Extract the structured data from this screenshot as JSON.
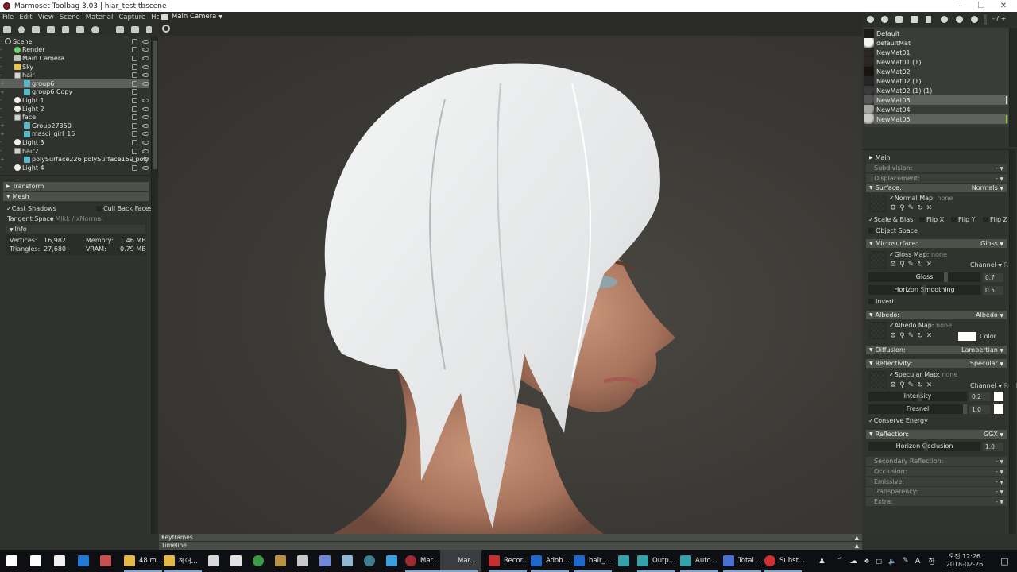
{
  "window": {
    "title": "Marmoset Toolbag 3.03  |  hiar_test.tbscene",
    "controls": [
      "minimize",
      "restore",
      "close"
    ]
  },
  "menu": [
    "File",
    "Edit",
    "View",
    "Scene",
    "Material",
    "Capture",
    "Help"
  ],
  "toolbar_left_icons": [
    "add-mesh-icon",
    "add-light-icon",
    "add-camera-icon",
    "add-sky-icon",
    "add-fog-icon",
    "add-shadow-catcher-icon",
    "add-turntable-icon",
    "folder-icon",
    "duplicate-icon",
    "delete-icon"
  ],
  "viewport": {
    "camera_label": "Main Camera",
    "keyframes_label": "Keyframes",
    "timeline_label": "Timeline"
  },
  "scene_tree": [
    {
      "label": "Scene",
      "icon": "scene",
      "depth": 0,
      "eye": true
    },
    {
      "label": "Render",
      "icon": "render",
      "depth": 1,
      "eye": true
    },
    {
      "label": "Main Camera",
      "icon": "cam",
      "depth": 1,
      "eye": true
    },
    {
      "label": "Sky",
      "icon": "sky",
      "depth": 1,
      "eye": true
    },
    {
      "label": "hair",
      "icon": "group",
      "depth": 1,
      "eye": true
    },
    {
      "label": "group6",
      "icon": "mesh",
      "depth": 2,
      "eye": true,
      "selected": true
    },
    {
      "label": "group6 Copy",
      "icon": "mesh",
      "depth": 2,
      "eye": false
    },
    {
      "label": "Light 1",
      "icon": "light",
      "depth": 1,
      "eye": true
    },
    {
      "label": "Light 2",
      "icon": "light",
      "depth": 1,
      "eye": true
    },
    {
      "label": "face",
      "icon": "group",
      "depth": 1,
      "eye": true
    },
    {
      "label": "Group27350",
      "icon": "mesh",
      "depth": 2,
      "eye": true
    },
    {
      "label": "masci_girl_15",
      "icon": "mesh",
      "depth": 2,
      "eye": true
    },
    {
      "label": "Light 3",
      "icon": "light",
      "depth": 1,
      "eye": true
    },
    {
      "label": "hair2",
      "icon": "group",
      "depth": 1,
      "eye": true
    },
    {
      "label": "polySurface226 polySurface159 poly",
      "icon": "mesh",
      "depth": 2,
      "eye": true
    },
    {
      "label": "Light 4",
      "icon": "light",
      "depth": 1,
      "eye": true
    }
  ],
  "object_props": {
    "transform_label": "Transform",
    "mesh_label": "Mesh",
    "cast_shadows": {
      "label": "Cast Shadows",
      "checked": true
    },
    "cull_back_faces": {
      "label": "Cull Back Faces",
      "checked": false
    },
    "tangent_space_label": "Tangent Space",
    "tangent_space_value": "Mikk / xNormal",
    "info_label": "Info",
    "vertices_label": "Vertices:",
    "vertices_value": "16,982",
    "triangles_label": "Triangles:",
    "triangles_value": "27,680",
    "memory_label": "Memory:",
    "memory_value": "1.46 MB",
    "vram_label": "VRAM:",
    "vram_value": "0.79 MB"
  },
  "material_toolbar": {
    "icons": [
      "add-material-icon",
      "duplicate-material-icon",
      "material-grid-icon",
      "folder-icon",
      "delete-icon",
      "pick-material-icon",
      "compass-icon",
      "search-material-icon"
    ],
    "zoom_label": "- / +"
  },
  "materials": [
    {
      "name": "Default",
      "thumb": "#1c1d1b"
    },
    {
      "name": "defaultMat",
      "thumb": "#f4f4f2"
    },
    {
      "name": "NewMat01",
      "thumb": "#2a2622"
    },
    {
      "name": "NewMat01 (1)",
      "thumb": "#2b2724"
    },
    {
      "name": "NewMat02",
      "thumb": "#1a1410"
    },
    {
      "name": "NewMat02 (1)",
      "thumb": "#262626"
    },
    {
      "name": "NewMat02 (1) (1)",
      "thumb": "#3a3a3a"
    },
    {
      "name": "NewMat03",
      "thumb": "#555",
      "selected": true
    },
    {
      "name": "NewMat04",
      "thumb": "#a6a6a2"
    },
    {
      "name": "NewMat05",
      "thumb": "#c9c9c5",
      "selected": true,
      "active": true
    }
  ],
  "material_props": {
    "main_label": "Main",
    "subdivision": {
      "label": "Subdivision:",
      "value": "-"
    },
    "displacement": {
      "label": "Displacement:",
      "value": "-"
    },
    "surface": {
      "label": "Surface:",
      "value": "Normals"
    },
    "normal_map": {
      "label": "Normal Map:",
      "value": "none"
    },
    "scale_bias": "Scale & Bias",
    "flip_x": "Flip X",
    "flip_y": "Flip Y",
    "flip_z": "Flip Z",
    "object_space": "Object Space",
    "microsurface": {
      "label": "Microsurface:",
      "value": "Gloss"
    },
    "gloss_map": {
      "label": "Gloss Map:",
      "value": "none"
    },
    "gloss_channel": {
      "label": "Channel",
      "value": "R"
    },
    "gloss": {
      "label": "Gloss",
      "value": "0.7",
      "fraction": 0.7
    },
    "horizon_smoothing": {
      "label": "Horizon Smoothing",
      "value": "0.5",
      "fraction": 0.5
    },
    "invert": "Invert",
    "albedo": {
      "label": "Albedo:",
      "value": "Albedo"
    },
    "albedo_map": {
      "label": "Albedo Map:",
      "value": "none"
    },
    "albedo_color_label": "Color",
    "albedo_color": "#ffffff",
    "diffusion": {
      "label": "Diffusion:",
      "value": "Lambertian"
    },
    "reflectivity": {
      "label": "Reflectivity:",
      "value": "Specular"
    },
    "specular_map": {
      "label": "Specular Map:",
      "value": "none"
    },
    "spec_channel": {
      "label": "Channel",
      "value": "RGB"
    },
    "intensity": {
      "label": "Intensity",
      "value": "0.2",
      "fraction": 0.2
    },
    "fresnel": {
      "label": "Fresnel",
      "value": "1.0",
      "fraction": 1.0
    },
    "conserve_energy": "Conserve Energy",
    "reflection": {
      "label": "Reflection:",
      "value": "GGX"
    },
    "horizon_occlusion": {
      "label": "Horizon Occlusion",
      "value": "1.0",
      "fraction": 1.0
    },
    "secondary_reflection": {
      "label": "Secondary Reflection:",
      "value": "-"
    },
    "occlusion": {
      "label": "Occlusion:",
      "value": "-"
    },
    "emissive": {
      "label": "Emissive:",
      "value": "-"
    },
    "transparency": {
      "label": "Transparency:",
      "value": "-"
    },
    "extra": {
      "label": "Extra:",
      "value": "-"
    }
  },
  "taskbar": {
    "items": [
      {
        "label": "",
        "icon": "start-icon",
        "color": "#ffffff"
      },
      {
        "label": "",
        "icon": "task-view-icon",
        "color": "#ffffff"
      },
      {
        "label": "",
        "icon": "mail-icon",
        "color": "#f0f0f0"
      },
      {
        "label": "",
        "icon": "edge-icon",
        "color": "#1f7ad6"
      },
      {
        "label": "",
        "icon": "paint-icon",
        "color": "#c85050"
      },
      {
        "label": "48.m...",
        "icon": "folder-icon",
        "color": "#e6b84a"
      },
      {
        "label": "헤어...",
        "icon": "folder-icon",
        "color": "#e6b84a"
      },
      {
        "label": "",
        "icon": "zbrush-icon",
        "color": "#d8d8d8"
      },
      {
        "label": "",
        "icon": "store-icon",
        "color": "#e2e2e2"
      },
      {
        "label": "",
        "icon": "chrome-icon",
        "color": "#3b9b46"
      },
      {
        "label": "",
        "icon": "league-icon",
        "color": "#b89347"
      },
      {
        "label": "",
        "icon": "recorder-icon",
        "color": "#c8c8c8"
      },
      {
        "label": "",
        "icon": "discord-icon",
        "color": "#7289da"
      },
      {
        "label": "",
        "icon": "app-icon",
        "color": "#8fb7d2"
      },
      {
        "label": "",
        "icon": "substance-icon",
        "color": "#3f7e8f"
      },
      {
        "label": "",
        "icon": "ie-icon",
        "color": "#3aa0e0"
      },
      {
        "label": "Mar...",
        "icon": "marmoset-icon",
        "color": "#9c2a33"
      },
      {
        "label": "Mar...",
        "icon": "marmoset-icon",
        "color": "#9c2a33",
        "active": true
      },
      {
        "label": "Recor...",
        "icon": "recorder-icon",
        "color": "#c23030"
      },
      {
        "label": "Adob...",
        "icon": "photoshop-icon",
        "color": "#1f68c9"
      },
      {
        "label": "hair_...",
        "icon": "photoshop-icon",
        "color": "#1f68c9"
      },
      {
        "label": "",
        "icon": "maya-icon",
        "color": "#33a3a9"
      },
      {
        "label": "Outp...",
        "icon": "maya-icon",
        "color": "#33a3a9"
      },
      {
        "label": "Auto...",
        "icon": "maya-icon",
        "color": "#33a3a9"
      },
      {
        "label": "Total ...",
        "icon": "total-commander-icon",
        "color": "#4a6fd1"
      },
      {
        "label": "Subst...",
        "icon": "substance-icon",
        "color": "#d03030"
      }
    ],
    "tray_icons": [
      "people-icon",
      "chevron-up-icon",
      "onedrive-icon",
      "dropbox-icon",
      "network-icon",
      "volume-icon",
      "pen-icon"
    ],
    "ime_a": "A",
    "ime_han": "한",
    "time": "오전 12:26",
    "date": "2018-02-26"
  }
}
